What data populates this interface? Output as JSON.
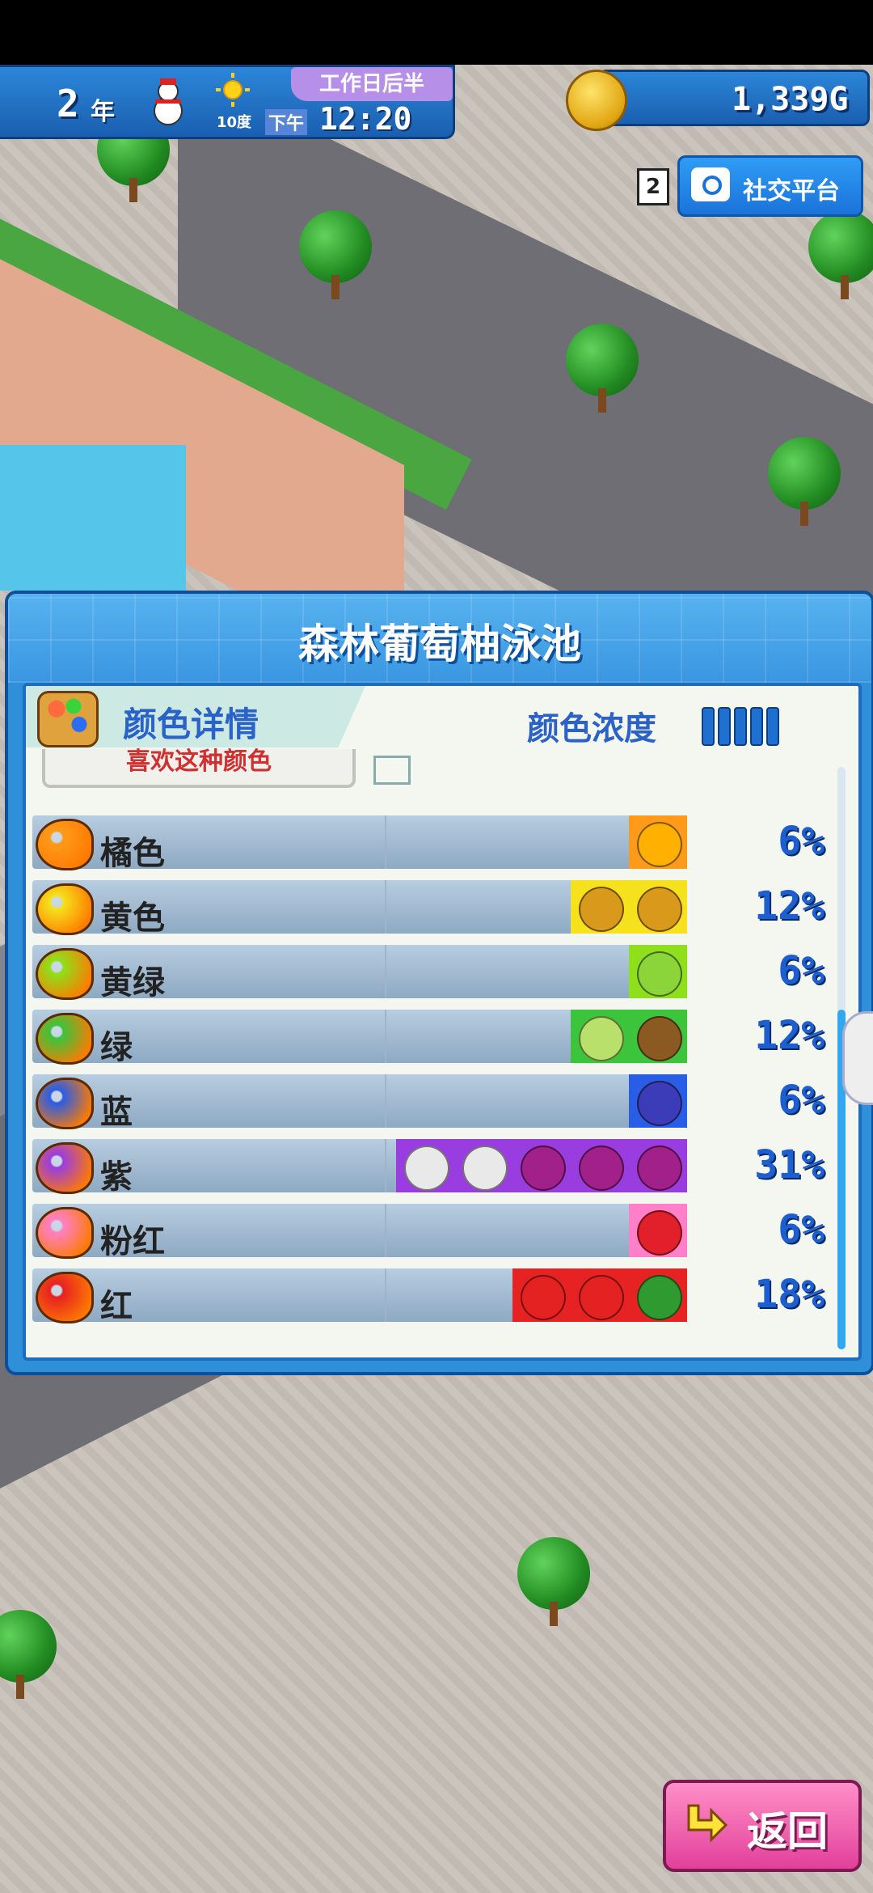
{
  "hud": {
    "year": "2",
    "year_unit": "年",
    "weather_label": "10度",
    "period": "工作日后半",
    "ampm": "下午",
    "time": "12:20",
    "money": "1,339G"
  },
  "social": {
    "count": "2",
    "label": "社交平台"
  },
  "panel": {
    "title": "森林葡萄柚泳池",
    "header_label": "颜色详情",
    "density_label": "颜色浓度",
    "partial_button": "喜欢这种颜色",
    "rows": [
      {
        "label": "橘色",
        "percent": "6%",
        "value": 6,
        "color": "#ff9a1a",
        "fruits": [
          "orange"
        ]
      },
      {
        "label": "黄色",
        "percent": "12%",
        "value": 12,
        "color": "#f5e21c",
        "fruits": [
          "pineapple",
          "pineapple"
        ]
      },
      {
        "label": "黄绿",
        "percent": "6%",
        "value": 6,
        "color": "#8ee01c",
        "fruits": [
          "pear"
        ]
      },
      {
        "label": "绿",
        "percent": "12%",
        "value": 12,
        "color": "#3cc43c",
        "fruits": [
          "kiwi",
          "kiwi-slice"
        ]
      },
      {
        "label": "蓝",
        "percent": "6%",
        "value": 6,
        "color": "#2a5de6",
        "fruits": [
          "blueberry"
        ]
      },
      {
        "label": "紫",
        "percent": "31%",
        "value": 31,
        "color": "#9a3de0",
        "fruits": [
          "grape",
          "grape",
          "grape",
          "jar",
          "jar"
        ]
      },
      {
        "label": "粉红",
        "percent": "6%",
        "value": 6,
        "color": "#ff80c8",
        "fruits": [
          "strawberry"
        ]
      },
      {
        "label": "红",
        "percent": "18%",
        "value": 18,
        "color": "#e62222",
        "fruits": [
          "watermelon",
          "apple",
          "apple"
        ]
      }
    ]
  },
  "back_label": "返回",
  "colors": {
    "panel_blue": "#2f8fd8",
    "accent_text": "#2a62c8",
    "back_pink": "#e2409a"
  },
  "icons": [
    "coin-icon",
    "camera-icon",
    "palette-icon",
    "snowman-icon",
    "sun-icon",
    "back-arrow-icon"
  ]
}
